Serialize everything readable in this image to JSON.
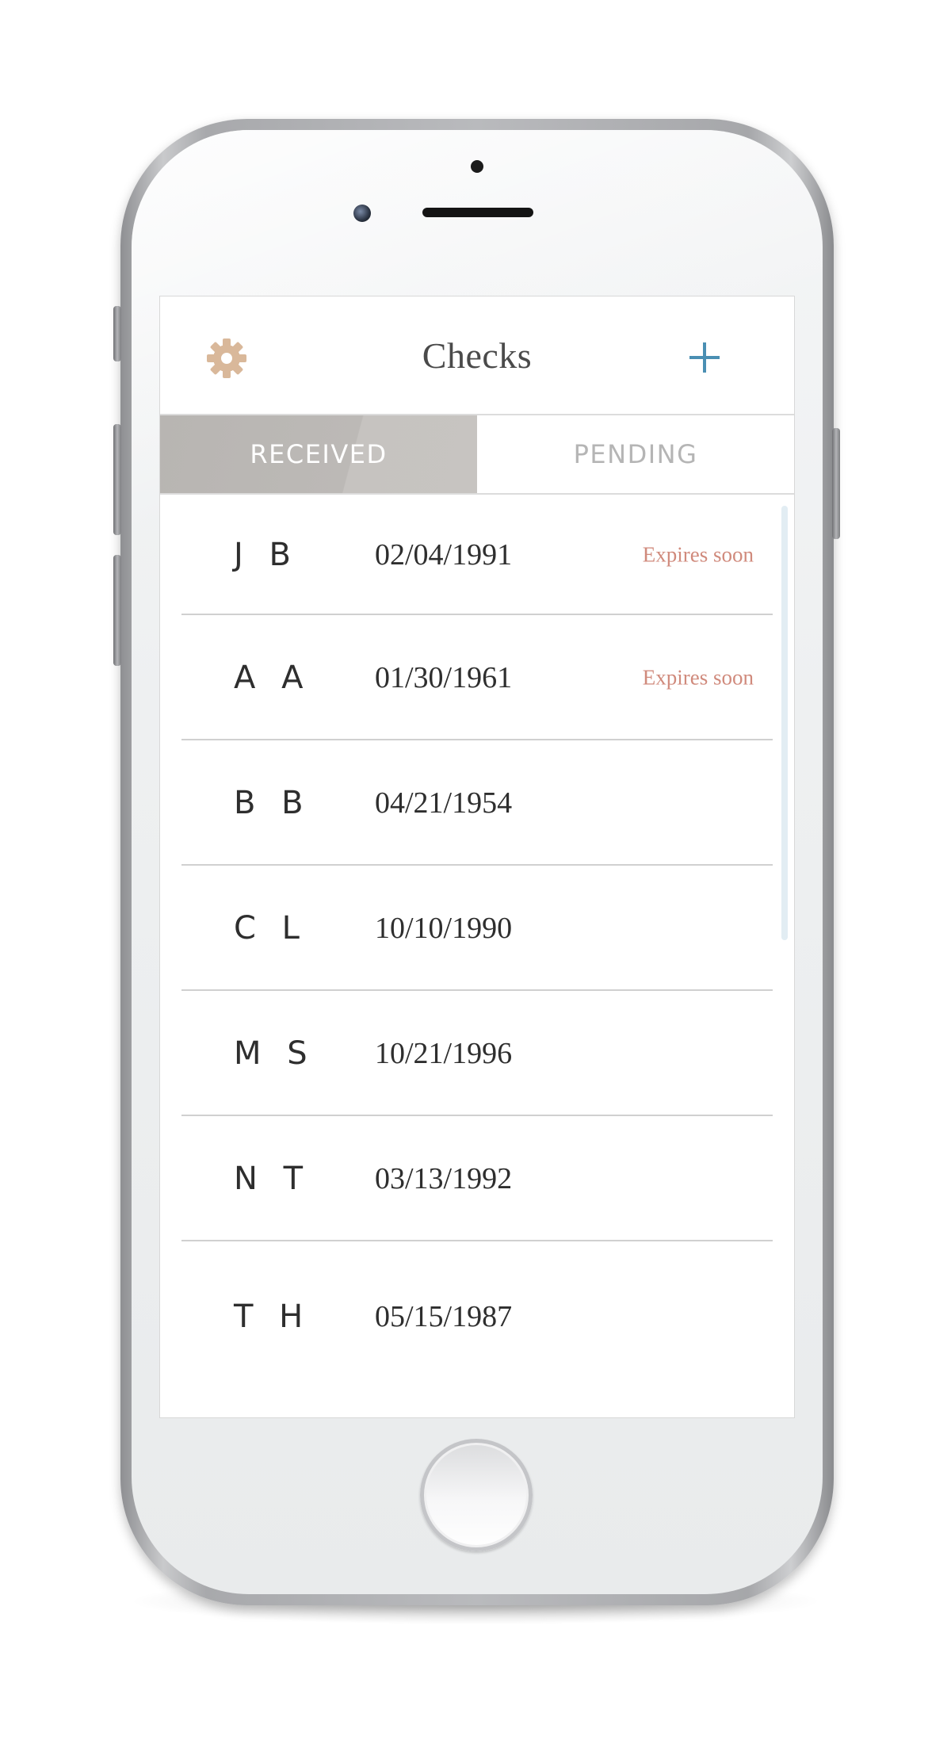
{
  "header": {
    "title": "Checks",
    "settings_icon": "gear-icon",
    "add_icon": "plus-icon"
  },
  "tabs": [
    {
      "label": "RECEIVED",
      "active": true
    },
    {
      "label": "PENDING",
      "active": false
    }
  ],
  "checks": [
    {
      "initials": "J B",
      "date": "02/04/1991",
      "status": "Expires soon"
    },
    {
      "initials": "A A",
      "date": "01/30/1961",
      "status": "Expires soon"
    },
    {
      "initials": "B B",
      "date": "04/21/1954",
      "status": ""
    },
    {
      "initials": "C L",
      "date": "10/10/1990",
      "status": ""
    },
    {
      "initials": "M S",
      "date": "10/21/1996",
      "status": ""
    },
    {
      "initials": "N T",
      "date": "03/13/1992",
      "status": ""
    },
    {
      "initials": "T H",
      "date": "05/15/1987",
      "status": ""
    }
  ],
  "colors": {
    "gear": "#d9b89a",
    "accent_plus": "#4a8fb3",
    "expiry_text": "#d08a7c",
    "active_tab_bg": "#bcb9b6"
  }
}
